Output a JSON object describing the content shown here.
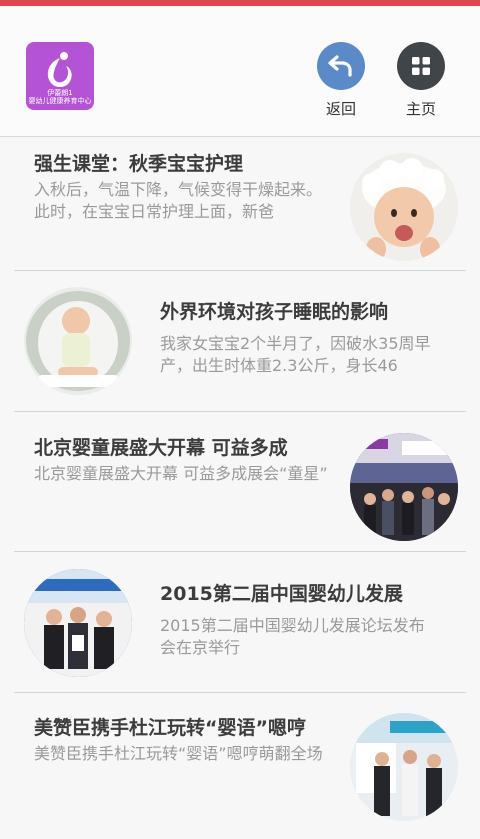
{
  "header": {
    "logo_lines": [
      "伊蕾朗1",
      "婴幼儿健康养育中心"
    ],
    "back_label": "返回",
    "home_label": "主页"
  },
  "articles": [
    {
      "title": "强生课堂：秋季宝宝护理",
      "desc": "入秋后，气温下降，气候变得干燥起来。此时，在宝宝日常护理上面，新爸"
    },
    {
      "title": "外界环境对孩子睡眠的影响",
      "desc": "我家女宝宝2个半月了，因破水35周早产，出生时体重2.3公斤，身长46"
    },
    {
      "title": "北京婴童展盛大开幕 可益多成",
      "desc": "北京婴童展盛大开幕 可益多成展会“童星”"
    },
    {
      "title": "2015第二届中国婴幼儿发展",
      "desc": "2015第二届中国婴幼儿发展论坛发布会在京举行"
    },
    {
      "title": "美赞臣携手杜江玩转“婴语”嗯哼",
      "desc": "美赞臣携手杜江玩转“婴语”嗯哼萌翻全场"
    }
  ],
  "colors": {
    "top_bar": "#e2474f",
    "back_button": "#5a8ac8",
    "home_button": "#404549",
    "logo_bg": "#b553d6"
  },
  "icons": {
    "back": "undo-arrow-icon",
    "home": "grid-icon"
  }
}
